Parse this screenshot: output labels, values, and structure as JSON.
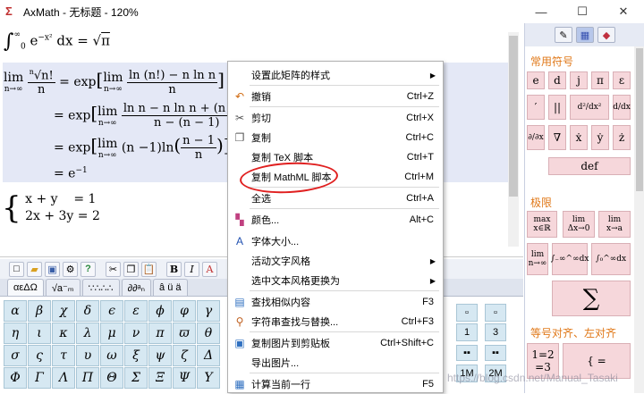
{
  "window": {
    "title": "AxMath - 无标题 - 120%",
    "minimize": "—",
    "maximize": "☐",
    "close": "✕"
  },
  "editor": {
    "line1": "∫₀^∞ e^(−x²) dx = √π",
    "block": [
      "lim(n→∞) ⁿ√(n!)/n = exp[lim(n→∞) (ln(n!) − n ln n)/n]",
      "= exp[lim(n→∞) (ln n − n ln n + (n − 1)…)/(n − (n − 1))]",
      "= exp[lim(n→∞) (n − 1) ln((n − 1)/n)]",
      "= e⁻¹"
    ],
    "system": [
      "x + y = 1",
      "2x + 3y = 2"
    ]
  },
  "toolbar": {
    "buttons": [
      "new",
      "open",
      "save",
      "settings",
      "help",
      "cut",
      "copy",
      "paste",
      "bold",
      "italic"
    ],
    "bold_label": "B",
    "italic_label": "I",
    "help_label": "?"
  },
  "symbol_tabs": [
    "αεΔΩ",
    "√a⁻ₘ",
    "∵∴∴∴",
    "∂∂ᵃₙ",
    "â ü ä",
    "→"
  ],
  "greek": [
    "α",
    "β",
    "χ",
    "δ",
    "ϵ",
    "ε",
    "ϕ",
    "φ",
    "γ",
    "η",
    "ι",
    "κ",
    "λ",
    "μ",
    "ν",
    "π",
    "ϖ",
    "θ",
    "σ",
    "ς",
    "τ",
    "υ",
    "ω",
    "ξ",
    "ψ",
    "ζ",
    "Δ",
    "Φ",
    "Γ",
    "Λ",
    "Π",
    "Θ",
    "Σ",
    "Ξ",
    "Ψ",
    "Υ"
  ],
  "struct_keys": [
    "1",
    "3",
    "1M",
    "2M"
  ],
  "right_panel": {
    "tabs": [
      "pencil-icon",
      "grid-icon",
      "eraser-icon"
    ],
    "section_common": "常用符号",
    "section_limit": "极限",
    "section_align": "等号对齐、左对齐",
    "common_keys": [
      "e",
      "d",
      "j",
      "π",
      "ε",
      "′",
      "||",
      "d²/dx²",
      "d/dx",
      "∂/∂x",
      "∇",
      "ẋ",
      "ẏ",
      "ż",
      "def"
    ],
    "limit_keys": [
      "max x∈ℝ",
      "lim Δx→0",
      "lim x→a",
      "lim n→∞",
      "∫₋∞^∞dx",
      "∫₀^∞dx",
      "∑"
    ],
    "align_keys": [
      "1=2 =3",
      "{ ="
    ]
  },
  "context_menu": {
    "items": [
      {
        "label": "设置此矩阵的样式",
        "shortcut": "",
        "submenu": true,
        "icon": ""
      },
      {
        "label": "撤销",
        "shortcut": "Ctrl+Z",
        "submenu": false,
        "icon": "undo-icon"
      },
      {
        "label": "剪切",
        "shortcut": "Ctrl+X",
        "submenu": false,
        "icon": "cut-icon"
      },
      {
        "label": "复制",
        "shortcut": "Ctrl+C",
        "submenu": false,
        "icon": "copy-icon"
      },
      {
        "label": "复制 TeX 脚本",
        "shortcut": "Ctrl+T",
        "submenu": false,
        "icon": ""
      },
      {
        "label": "复制 MathML 脚本",
        "shortcut": "Ctrl+M",
        "submenu": false,
        "icon": ""
      },
      {
        "label": "全选",
        "shortcut": "Ctrl+A",
        "submenu": false,
        "icon": ""
      },
      {
        "label": "颜色...",
        "shortcut": "Alt+C",
        "submenu": false,
        "icon": "palette-icon"
      },
      {
        "label": "字体大小...",
        "shortcut": "",
        "submenu": false,
        "icon": "font-size-icon"
      },
      {
        "label": "活动文字风格",
        "shortcut": "",
        "submenu": true,
        "icon": ""
      },
      {
        "label": "选中文本风格更换为",
        "shortcut": "",
        "submenu": true,
        "icon": ""
      },
      {
        "label": "查找相似内容",
        "shortcut": "F3",
        "submenu": false,
        "icon": "find-icon"
      },
      {
        "label": "字符串查找与替换...",
        "shortcut": "Ctrl+F3",
        "submenu": false,
        "icon": "replace-icon"
      },
      {
        "label": "复制图片到剪贴板",
        "shortcut": "Ctrl+Shift+C",
        "submenu": false,
        "icon": "image-icon"
      },
      {
        "label": "导出图片...",
        "shortcut": "",
        "submenu": false,
        "icon": ""
      },
      {
        "label": "计算当前一行",
        "shortcut": "F5",
        "submenu": false,
        "icon": "calc-icon"
      }
    ]
  },
  "watermark": "https://blog.csdn.net/Manual_Tasaki"
}
